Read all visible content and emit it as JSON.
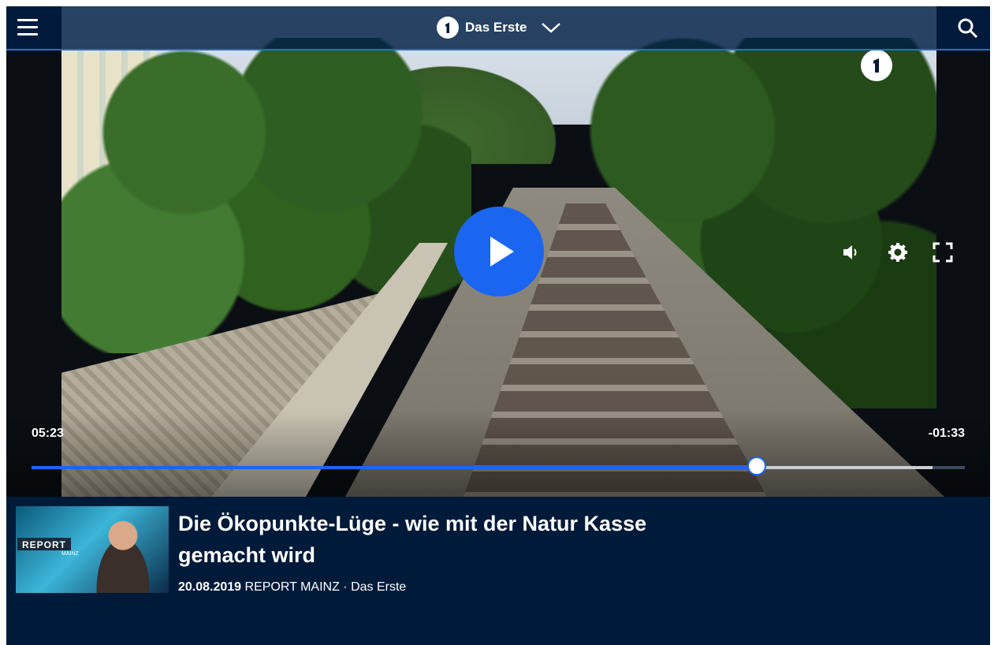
{
  "header": {
    "menu_icon": "hamburger-menu-icon",
    "brand_name": "Das Erste",
    "brand_logo": "das-erste-logo",
    "brand_chevron": "chevron-down-icon",
    "search_icon": "search-icon"
  },
  "player": {
    "watermark": "das-erste-logo",
    "play_icon": "play-icon",
    "volume_icon": "volume-icon",
    "settings_icon": "gear-icon",
    "fullscreen_icon": "fullscreen-icon",
    "time_elapsed": "05:23",
    "time_remaining": "-01:33",
    "progress_played_fraction": 0.777,
    "progress_buffered_fraction": 0.965,
    "accent_color": "#1b66f0"
  },
  "video_info": {
    "thumbnail": {
      "label": "REPORT",
      "sublabel": "MAINZ"
    },
    "title": "Die Ökopunkte-Lüge - wie mit der Natur Kasse gemacht wird",
    "date": "20.08.2019",
    "program": "REPORT MAINZ · Das Erste"
  }
}
